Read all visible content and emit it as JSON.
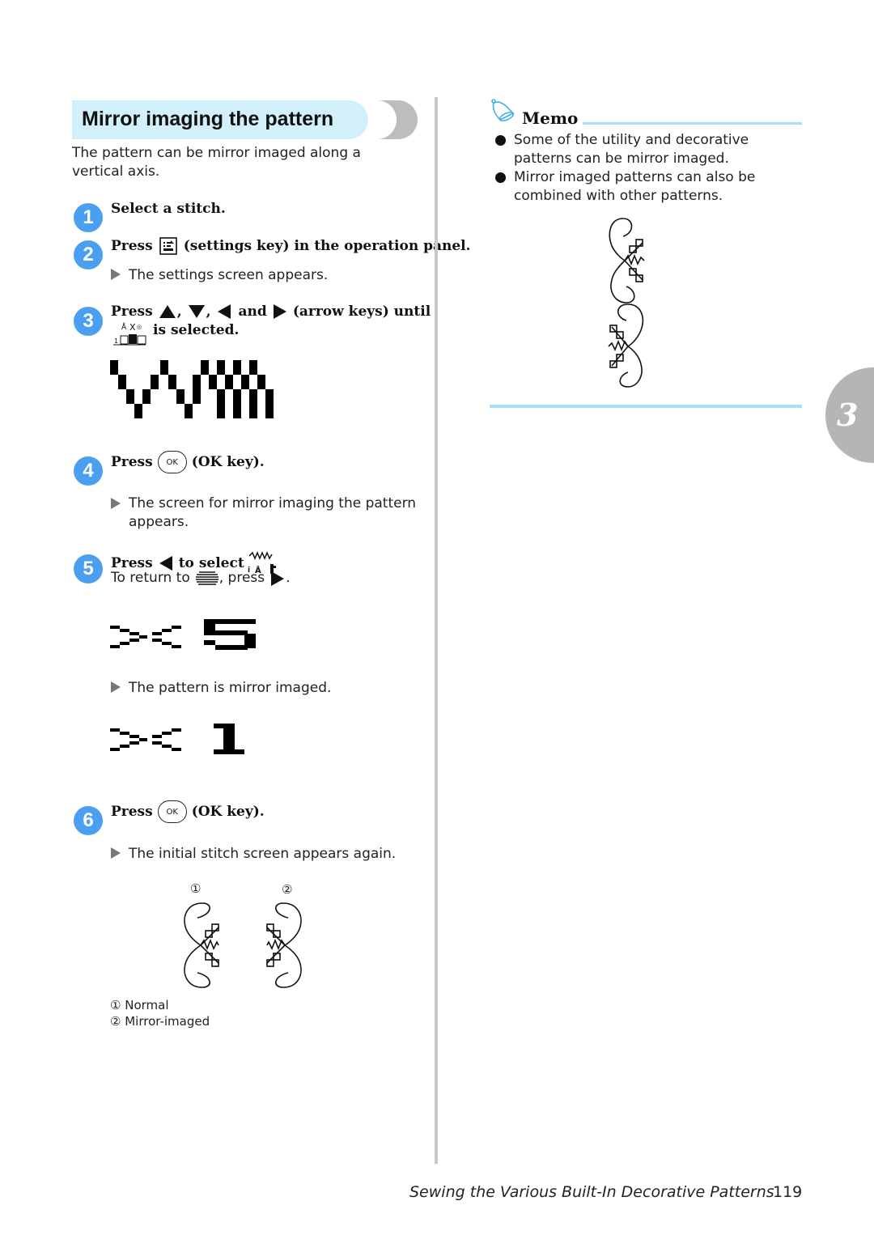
{
  "section": {
    "title": "Mirror imaging the pattern",
    "intro": "The pattern can be mirror imaged along a vertical axis.",
    "title_bar_color": "#d2f0fc",
    "step_color": "#4a9ff0"
  },
  "steps": [
    {
      "number": "1",
      "instruction": "Select a stitch."
    },
    {
      "number": "2",
      "press": "Press",
      "icon": "settings-key-icon",
      "instruction_rest": "(settings key) in the operation panel.",
      "result": "The settings screen appears."
    },
    {
      "number": "3",
      "press": "Press",
      "sep1": ",",
      "sep2": ",",
      "and": "and",
      "instruction_rest": "(arrow keys) until",
      "line2": "is selected."
    },
    {
      "number": "4",
      "press": "Press",
      "key_label": "OK",
      "instruction_rest": "(OK key).",
      "result": "The screen for mirror imaging the pattern appears."
    },
    {
      "number": "5",
      "press": "Press",
      "instruction_rest": "to select",
      "note_prefix": "To return to",
      "note_mid": ", press",
      "note_end": ".",
      "result": "The pattern is mirror imaged."
    },
    {
      "number": "6",
      "press": "Press",
      "key_label": "OK",
      "instruction_rest": "(OK key).",
      "result": "The initial stitch screen appears again."
    }
  ],
  "lcd": {
    "before_value": "5",
    "after_value": "1"
  },
  "figure": {
    "label_1": "①",
    "label_2": "②",
    "legend": [
      {
        "mark": "①",
        "text": "Normal"
      },
      {
        "mark": "②",
        "text": "Mirror-imaged"
      }
    ]
  },
  "memo": {
    "title": "Memo",
    "items": [
      "Some of the utility and decorative patterns can be mirror imaged.",
      "Mirror imaged patterns can also be combined with other patterns."
    ],
    "accent_color": "#a6dff8"
  },
  "chapter": {
    "number": "3"
  },
  "footer": {
    "title": "Sewing the Various Built-In Decorative Patterns",
    "page": "119"
  }
}
